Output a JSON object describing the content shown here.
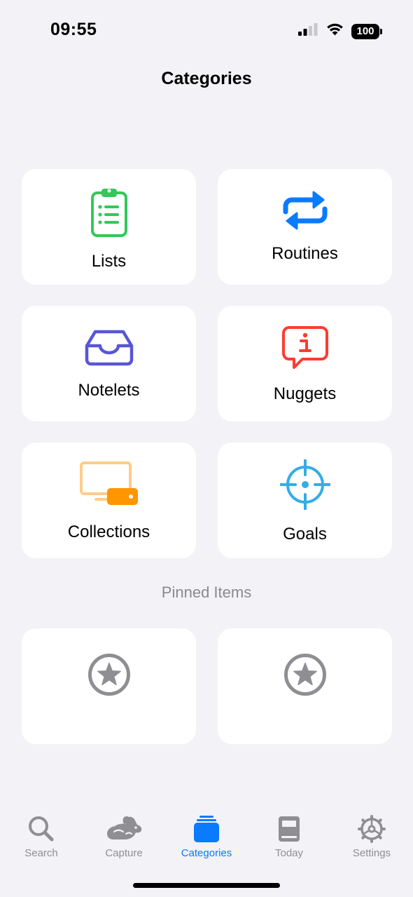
{
  "status_bar": {
    "time": "09:55",
    "battery": "100",
    "icons": [
      "cellular-signal-icon",
      "wifi-icon",
      "battery-icon"
    ]
  },
  "header": {
    "title": "Categories"
  },
  "categories": [
    {
      "label": "Lists",
      "icon": "clipboard-list-icon",
      "color": "#34c759"
    },
    {
      "label": "Routines",
      "icon": "repeat-arrows-icon",
      "color": "#0a7aff"
    },
    {
      "label": "Notelets",
      "icon": "inbox-tray-icon",
      "color": "#5856d6"
    },
    {
      "label": "Nuggets",
      "icon": "info-bubble-icon",
      "color": "#ff3b30"
    },
    {
      "label": "Collections",
      "icon": "display-drive-icon",
      "color": "#ff9500"
    },
    {
      "label": "Goals",
      "icon": "crosshair-target-icon",
      "color": "#32ade6"
    }
  ],
  "pinned": {
    "title": "Pinned Items",
    "items": [
      {
        "icon": "star-circle-icon"
      },
      {
        "icon": "star-circle-icon"
      }
    ]
  },
  "tab_bar": {
    "tabs": [
      {
        "label": "Search",
        "icon": "magnifier-icon"
      },
      {
        "label": "Capture",
        "icon": "rabbit-icon"
      },
      {
        "label": "Categories",
        "icon": "stack-icon",
        "active": true
      },
      {
        "label": "Today",
        "icon": "book-icon"
      },
      {
        "label": "Settings",
        "icon": "gear-icon"
      }
    ],
    "active_color": "#0a7aff",
    "inactive_color": "#8e8e93"
  }
}
